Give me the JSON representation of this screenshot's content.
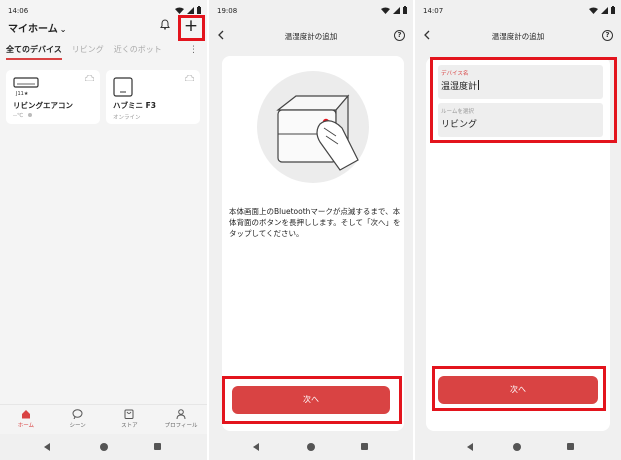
{
  "accent_color": "#d94343",
  "highlight_color": "#e3141d",
  "screen1": {
    "time": "14:06",
    "home_title": "マイホーム",
    "header_icons": [
      "bell-icon",
      "plus-icon"
    ],
    "add_button_label": "+",
    "tabs": [
      {
        "label": "全てのデバイス",
        "active": true
      },
      {
        "label": "リビング",
        "active": false
      },
      {
        "label": "近くのボット",
        "active": false
      }
    ],
    "kebab_label": "⋮",
    "devices": [
      {
        "name": "リビングエアコン",
        "status": "--℃",
        "icon": "air-conditioner-icon",
        "display_text": "J11★"
      },
      {
        "name": "ハブミニ F3",
        "status": "オンライン",
        "icon": "hub-mini-icon"
      }
    ],
    "bottom_tabs": [
      {
        "label": "ホーム",
        "icon": "home-icon",
        "active": true
      },
      {
        "label": "シーン",
        "icon": "scene-icon",
        "active": false
      },
      {
        "label": "ストア",
        "icon": "store-icon",
        "active": false
      },
      {
        "label": "プロフィール",
        "icon": "profile-icon",
        "active": false
      }
    ]
  },
  "screen2": {
    "time": "19:08",
    "title": "温湿度計の追加",
    "help_label": "?",
    "instruction": "本体画面上のBluetoothマークが点滅するまで、本体背面のボタンを長押しします。そして「次へ」をタップしてください。",
    "next_label": "次へ"
  },
  "screen3": {
    "time": "14:07",
    "title": "温湿度計の追加",
    "help_label": "?",
    "device_name_label": "デバイス名",
    "device_name_value": "温湿度計",
    "room_label": "ルームを選択",
    "room_value": "リビング",
    "next_label": "次へ"
  }
}
